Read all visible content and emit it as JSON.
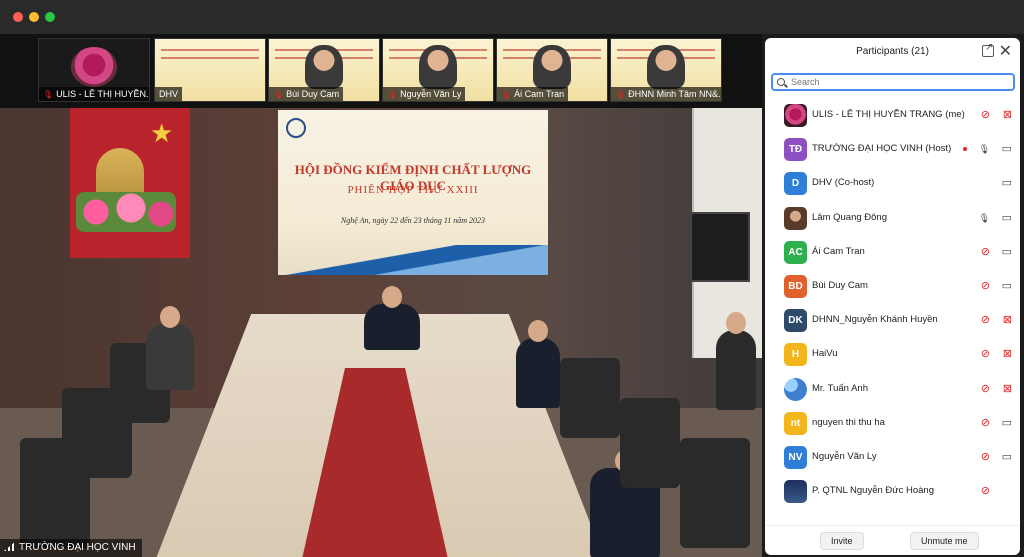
{
  "thumbnails": [
    {
      "name": "ULIS - LÊ THỊ HUYỀN...",
      "muted": true,
      "kind": "flower"
    },
    {
      "name": "DHV",
      "muted": false,
      "kind": "banner"
    },
    {
      "name": "Bùi Duy Cam",
      "muted": true,
      "kind": "person"
    },
    {
      "name": "Nguyễn Văn Ly",
      "muted": true,
      "kind": "person"
    },
    {
      "name": "Ái Cam Tran",
      "muted": true,
      "kind": "person"
    },
    {
      "name": "ĐHNN Minh Tâm NN&...",
      "muted": true,
      "kind": "person"
    }
  ],
  "main_video": {
    "speaker_label": "TRƯỜNG ĐẠI HỌC VINH",
    "backdrop": {
      "title1": "HỘI ĐỒNG KIỂM ĐỊNH CHẤT LƯỢNG GIÁO DỤC",
      "title2": "PHIÊN HỌP THỨ XXIII",
      "date": "Nghệ An, ngày 22 đến 23 tháng 11 năm 2023"
    }
  },
  "panel": {
    "title": "Participants (21)",
    "search_placeholder": "Search",
    "invite_label": "Invite",
    "unmute_label": "Unmute me",
    "participants": [
      {
        "name": "ULIS - LÊ THỊ HUYỀN TRANG (me)",
        "initials": "",
        "color": "#9b1d5a",
        "photo": "flower",
        "mic": "muted",
        "cam": "off",
        "dot": false
      },
      {
        "name": "TRƯỜNG ĐẠI HỌC VINH (Host)",
        "initials": "TĐ",
        "color": "#8e4fc0",
        "photo": "",
        "mic": "on",
        "cam": "on",
        "dot": true
      },
      {
        "name": "DHV (Co-host)",
        "initials": "D",
        "color": "#2f7fd8",
        "photo": "",
        "mic": "none",
        "cam": "on",
        "dot": false
      },
      {
        "name": "Lâm Quang Đông",
        "initials": "",
        "color": "#7a5a40",
        "photo": "person",
        "mic": "on",
        "cam": "on",
        "dot": false
      },
      {
        "name": "Ái Cam Tran",
        "initials": "AC",
        "color": "#2fb04f",
        "photo": "",
        "mic": "muted",
        "cam": "on",
        "dot": false
      },
      {
        "name": "Bùi Duy Cam",
        "initials": "BD",
        "color": "#e0612c",
        "photo": "",
        "mic": "muted",
        "cam": "on",
        "dot": false
      },
      {
        "name": "DHNN_Nguyễn Khánh Huyền",
        "initials": "DK",
        "color": "#2e4a6b",
        "photo": "",
        "mic": "muted",
        "cam": "off",
        "dot": false
      },
      {
        "name": "HaiVu",
        "initials": "H",
        "color": "#f2b51c",
        "photo": "",
        "mic": "muted",
        "cam": "off",
        "dot": false
      },
      {
        "name": "Mr. Tuấn Anh",
        "initials": "",
        "color": "#3f7fd0",
        "photo": "abstract",
        "mic": "muted",
        "cam": "off",
        "dot": false
      },
      {
        "name": "nguyen thi thu ha",
        "initials": "nt",
        "color": "#f2b51c",
        "photo": "",
        "mic": "muted",
        "cam": "on",
        "dot": false
      },
      {
        "name": "Nguyễn Văn Ly",
        "initials": "NV",
        "color": "#2f7fd8",
        "photo": "",
        "mic": "muted",
        "cam": "on",
        "dot": false
      },
      {
        "name": "P. QTNL Nguyễn Đức Hoàng",
        "initials": "",
        "color": "#1d2f5a",
        "photo": "crest",
        "mic": "muted",
        "cam": "none",
        "dot": false
      }
    ]
  }
}
